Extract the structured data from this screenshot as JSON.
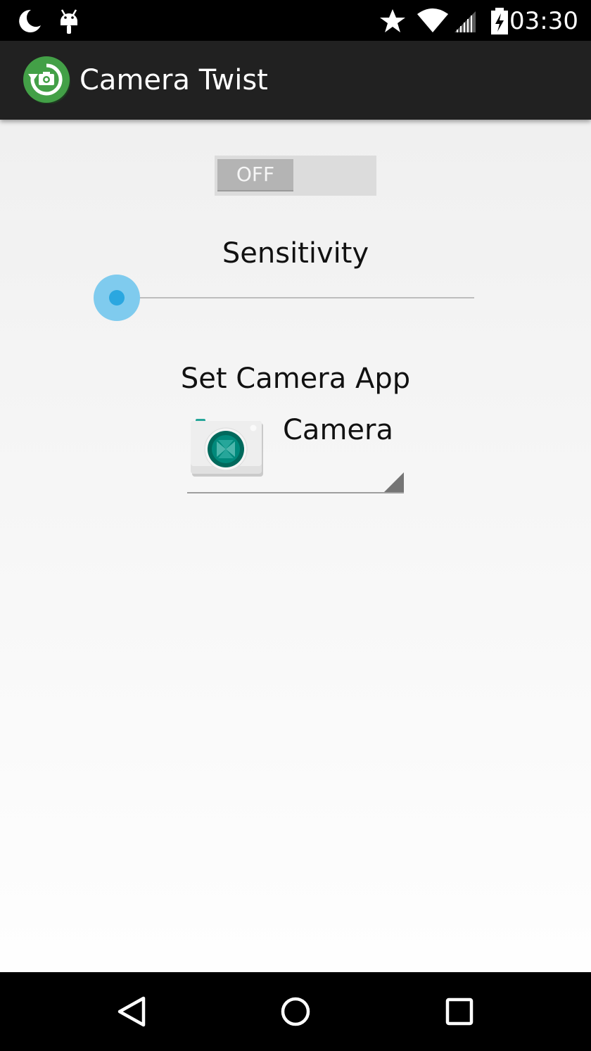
{
  "status_bar": {
    "time": "03:30",
    "icons": [
      "moon-icon",
      "android-icon",
      "star-icon",
      "wifi-icon",
      "signal-icon",
      "battery-charging-icon"
    ]
  },
  "action_bar": {
    "title": "Camera Twist",
    "icon": "camera-rotate-icon",
    "background_color": "#212121",
    "icon_color": "#43a047"
  },
  "toggle": {
    "label": "OFF",
    "state": "off"
  },
  "sensitivity": {
    "label": "Sensitivity",
    "value_fraction": 0,
    "accent_color": "#2aa7e0"
  },
  "camera_app": {
    "label": "Set Camera App",
    "selected": "Camera",
    "icon": "camera-app-icon"
  },
  "nav_bar": {
    "buttons": [
      "back-icon",
      "home-icon",
      "recents-icon"
    ]
  }
}
